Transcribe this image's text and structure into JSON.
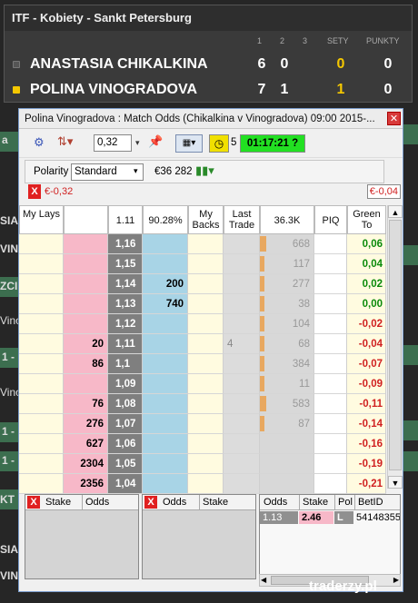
{
  "scoreboard": {
    "title": "ITF - Kobiety - Sankt Petersburg",
    "headers": [
      "1",
      "2",
      "3",
      "SETY",
      "PUNKTY"
    ],
    "players": [
      {
        "name": "ANASTASIA CHIKALKINA",
        "set1": "6",
        "set2": "0",
        "sets": "0",
        "points": "0"
      },
      {
        "name": "POLINA VINOGRADOVA",
        "set1": "7",
        "set2": "1",
        "sets": "1",
        "points": "0"
      }
    ]
  },
  "background": {
    "left": [
      "a",
      "SIA",
      "VINO",
      "ZCI",
      "Vino",
      "1 -",
      "Vino",
      "1 -",
      "1 -",
      "KT",
      "SIA",
      "VINO"
    ]
  },
  "window": {
    "title": "Polina Vinogradova : Match Odds (Chikalkina v Vinogradova) 09:00 2015-..."
  },
  "toolbar": {
    "stake_value": "0,32",
    "timer_count": "5",
    "match_clock": "01:17:21 ?",
    "polarity_label": "Polarity",
    "polarity_value": "Standard",
    "matched_volume": "€36 282",
    "pl_left": "€-0,32",
    "pl_right": "€-0,04"
  },
  "ladder": {
    "headers": [
      "My Lays",
      "1.11",
      "90.28%",
      "My Backs",
      "Last Trade",
      "36.3K",
      "PIQ",
      "Green To"
    ],
    "rows": [
      {
        "lay": "",
        "price": "1,16",
        "back": "",
        "vol": "668",
        "volfrac": 0.6,
        "green": "0,06",
        "trade": ""
      },
      {
        "lay": "",
        "price": "1,15",
        "back": "",
        "vol": "117",
        "volfrac": 0.1,
        "green": "0,04",
        "trade": ""
      },
      {
        "lay": "",
        "price": "1,14",
        "back": "200",
        "vol": "277",
        "volfrac": 0.25,
        "green": "0,02",
        "trade": ""
      },
      {
        "lay": "",
        "price": "1,13",
        "back": "740",
        "vol": "38",
        "volfrac": 0.05,
        "green": "0,00",
        "trade": ""
      },
      {
        "lay": "",
        "price": "1,12",
        "back": "",
        "vol": "104",
        "volfrac": 0.1,
        "green": "-0,02",
        "trade": ""
      },
      {
        "lay": "20",
        "price": "1,11",
        "back": "",
        "vol": "68",
        "volfrac": 0.07,
        "green": "-0,04",
        "trade": "4"
      },
      {
        "lay": "86",
        "price": "1,1",
        "back": "",
        "vol": "384",
        "volfrac": 0.35,
        "green": "-0,07",
        "trade": ""
      },
      {
        "lay": "",
        "price": "1,09",
        "back": "",
        "vol": "11",
        "volfrac": 0.02,
        "green": "-0,09",
        "trade": ""
      },
      {
        "lay": "76",
        "price": "1,08",
        "back": "",
        "vol": "583",
        "volfrac": 0.55,
        "green": "-0,11",
        "trade": ""
      },
      {
        "lay": "276",
        "price": "1,07",
        "back": "",
        "vol": "87",
        "volfrac": 0.08,
        "green": "-0,14",
        "trade": ""
      },
      {
        "lay": "627",
        "price": "1,06",
        "back": "",
        "vol": "",
        "volfrac": 0,
        "green": "-0,16",
        "trade": ""
      },
      {
        "lay": "2304",
        "price": "1,05",
        "back": "",
        "vol": "",
        "volfrac": 0,
        "green": "-0,19",
        "trade": ""
      },
      {
        "lay": "2356",
        "price": "1,04",
        "back": "",
        "vol": "",
        "volfrac": 0,
        "green": "-0,21",
        "trade": ""
      }
    ]
  },
  "orders": {
    "back_headers": [
      "Stake",
      "Odds"
    ],
    "lay_headers": [
      "Odds",
      "Stake"
    ]
  },
  "matched": {
    "headers": [
      "Odds",
      "Stake",
      "Pol",
      "BetID"
    ],
    "row": {
      "odds": "1.13",
      "stake": "2.46",
      "pol": "L",
      "bet_id": "54148355"
    }
  },
  "watermark": "traderzy.pl",
  "colors": {
    "lay_pink": "#f7b8c8",
    "back_blue": "#a8d4e6",
    "price_grey": "#7f7f7f",
    "green_text": "#0a8a0a",
    "red_text": "#d02020",
    "match_clock_bg": "#22e022",
    "sets_yellow": "#f5c800"
  }
}
